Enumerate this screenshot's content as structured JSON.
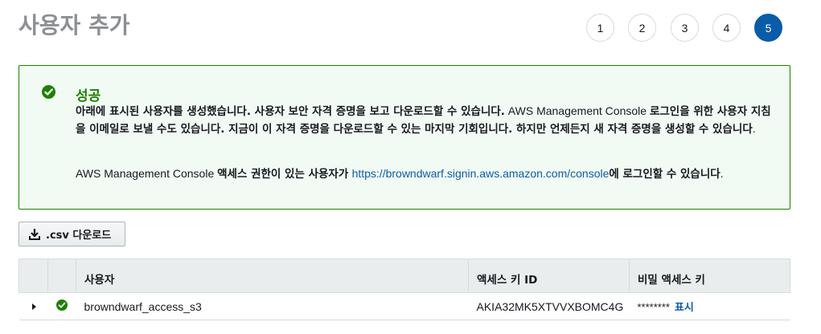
{
  "page": {
    "title": "사용자 추가"
  },
  "steps": [
    {
      "label": "1",
      "active": false
    },
    {
      "label": "2",
      "active": false
    },
    {
      "label": "3",
      "active": false
    },
    {
      "label": "4",
      "active": false
    },
    {
      "label": "5",
      "active": true
    }
  ],
  "alert": {
    "title": "성공",
    "p1_a": "아래에 표시된 사용자를 생성했습니다. 사용자 보안 자격 증명을 보고 다운로드할 수 있습니다.",
    "p1_b": " AWS Management Console ",
    "p1_c": "로그인을 위한 사용자 지침을 이메일로 보낼 수도 있습니다. 지금이 이 자격 증명을 다운로드할 수 있는 마지막 기회입니다. 하지만 언제든지 새 자격 증명을 생성할 수 있습니다",
    "p1_d": ".",
    "p2_a": "AWS Management Console ",
    "p2_b": "액세스 권한이 있는 사용자가",
    "p2_link": "https://browndwarf.signin.aws.amazon.com/console",
    "p2_c": "에 로그인할 수 있습니다",
    "p2_d": "."
  },
  "csv_button": {
    "label": ".csv 다운로드"
  },
  "table": {
    "headers": {
      "user": "사용자",
      "access_key": "액세스 키 ID",
      "secret": "비밀 액세스 키"
    },
    "rows": [
      {
        "user": "browndwarf_access_s3",
        "access_key": "AKIA32MK5XTVVXBOMC4G",
        "secret_mask": "********",
        "show_label": "표시"
      }
    ]
  },
  "colors": {
    "accent": "#0a5ca8",
    "success": "#1d8102",
    "alert_bg": "#f2faf4",
    "title_gray": "#8c8f93"
  }
}
